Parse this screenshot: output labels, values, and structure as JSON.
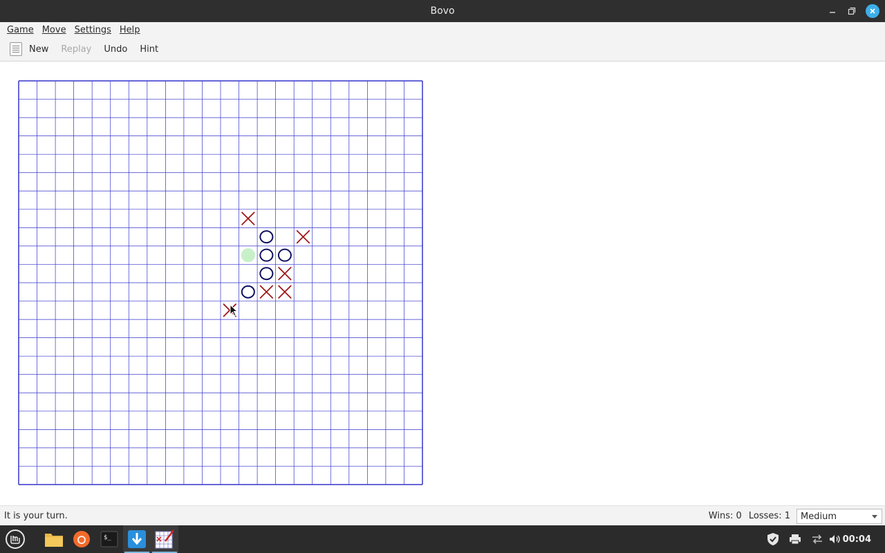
{
  "window": {
    "title": "Bovo"
  },
  "menu": [
    {
      "label": "Game",
      "name": "menu-game"
    },
    {
      "label": "Move",
      "name": "menu-move"
    },
    {
      "label": "Settings",
      "name": "menu-settings"
    },
    {
      "label": "Help",
      "name": "menu-help"
    }
  ],
  "toolbar": {
    "new_label": "New",
    "replay_label": "Replay",
    "undo_label": "Undo",
    "hint_label": "Hint"
  },
  "board": {
    "size": 22,
    "grid_color": "#3333cc",
    "x_color": "#a01818",
    "o_color": "#101060",
    "hint_color": "#c8f0c8",
    "pieces": [
      {
        "r": 7,
        "c": 12,
        "p": "X"
      },
      {
        "r": 8,
        "c": 13,
        "p": "O"
      },
      {
        "r": 8,
        "c": 15,
        "p": "X"
      },
      {
        "r": 9,
        "c": 13,
        "p": "O"
      },
      {
        "r": 9,
        "c": 14,
        "p": "O"
      },
      {
        "r": 10,
        "c": 13,
        "p": "O"
      },
      {
        "r": 10,
        "c": 14,
        "p": "X"
      },
      {
        "r": 11,
        "c": 12,
        "p": "O"
      },
      {
        "r": 11,
        "c": 13,
        "p": "X"
      },
      {
        "r": 11,
        "c": 14,
        "p": "X"
      },
      {
        "r": 12,
        "c": 11,
        "p": "X"
      }
    ],
    "hint": {
      "r": 9,
      "c": 12
    }
  },
  "status": {
    "message": "It is your turn.",
    "wins": "Wins: 0",
    "losses": "Losses: 1",
    "difficulty": "Medium"
  },
  "taskbar": {
    "clock": "00:04"
  }
}
